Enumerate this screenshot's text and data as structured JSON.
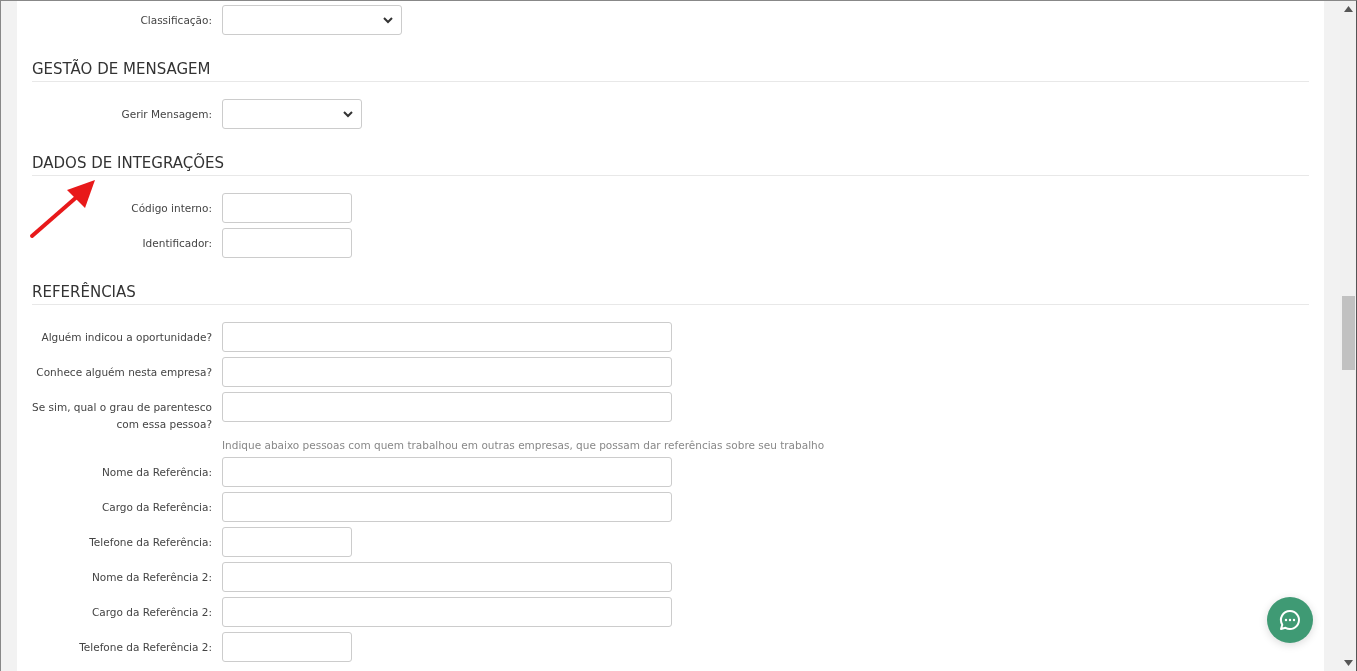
{
  "sections": [
    {
      "items": [
        {
          "kind": "wide-select",
          "label": "Classificação:"
        }
      ]
    },
    {
      "title": "GESTÃO DE MENSAGEM",
      "items": [
        {
          "kind": "select",
          "label": "Gerir Mensagem:"
        }
      ]
    },
    {
      "title": "DADOS DE INTEGRAÇÕES",
      "items": [
        {
          "kind": "short-input",
          "label": "Código interno:"
        },
        {
          "kind": "short-input",
          "label": "Identificador:"
        }
      ]
    },
    {
      "title": "REFERÊNCIAS",
      "items": [
        {
          "kind": "long-input",
          "label": "Alguém indicou a oportunidade?"
        },
        {
          "kind": "long-input",
          "label": "Conhece alguém nesta empresa?"
        },
        {
          "kind": "long-input",
          "label": "Se sim, qual o grau de parentesco com essa pessoa?"
        },
        {
          "kind": "hint",
          "text": "Indique abaixo pessoas com quem trabalhou em outras empresas, que possam dar referências sobre seu trabalho"
        },
        {
          "kind": "long-input",
          "label": "Nome da Referência:"
        },
        {
          "kind": "long-input",
          "label": "Cargo da Referência:"
        },
        {
          "kind": "short-input",
          "label": "Telefone da Referência:"
        },
        {
          "kind": "long-input",
          "label": "Nome da Referência 2:"
        },
        {
          "kind": "long-input",
          "label": "Cargo da Referência 2:"
        },
        {
          "kind": "short-input",
          "label": "Telefone da Referência 2:"
        }
      ]
    }
  ]
}
